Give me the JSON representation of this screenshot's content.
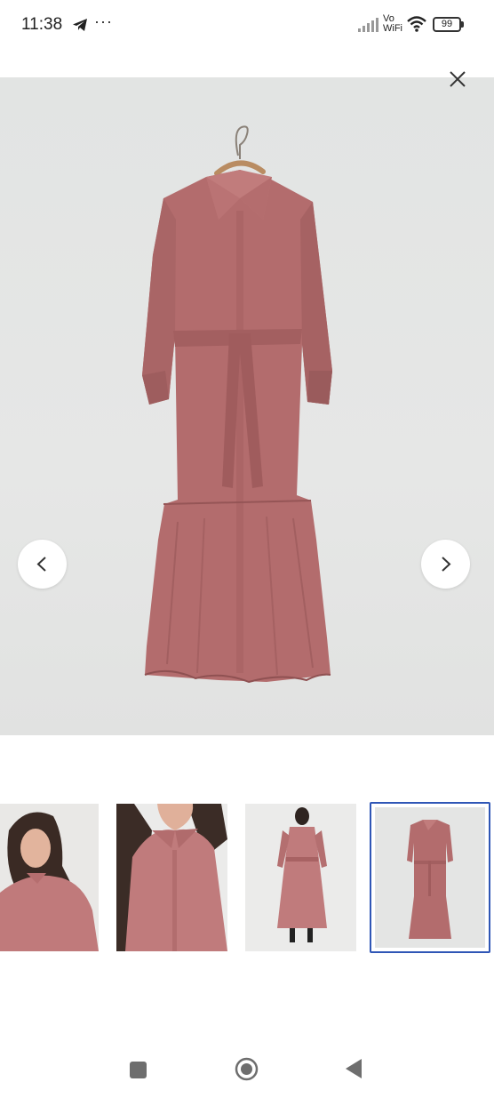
{
  "status_bar": {
    "time": "11:38",
    "dots": "···",
    "vo_label": "Vo",
    "wifi_label": "WiFi",
    "battery_level": "99"
  },
  "gallery": {
    "main_image_alt_icon": "dress-on-hanger",
    "product_color": "#b96f70",
    "background_color": "#e4e5e4",
    "selected_index": 4,
    "thumbnails": [
      "model-portrait",
      "collar-closeup",
      "model-full-back",
      "dress-on-hanger"
    ],
    "thumbnail_count": 4
  },
  "colors": {
    "accent": "#2f56b6",
    "nav_gray": "#6e6e6e"
  }
}
